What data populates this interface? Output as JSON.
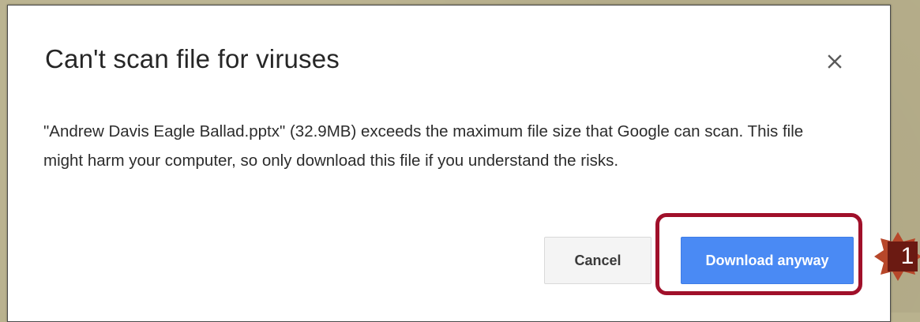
{
  "dialog": {
    "title": "Can't scan file for viruses",
    "close_icon": "close-icon",
    "message": "\"Andrew Davis Eagle Ballad.pptx\" (32.9MB) exceeds the maximum file size that Google can scan. This file might harm your computer, so only download this file if you understand the risks.",
    "cancel_label": "Cancel",
    "download_label": "Download anyway"
  },
  "annotation": {
    "step_number": "1",
    "highlight_color": "#a0102a",
    "marker_color": "#6b1a12"
  },
  "colors": {
    "primary_button": "#4a8af4",
    "background": "#b8b08c"
  }
}
